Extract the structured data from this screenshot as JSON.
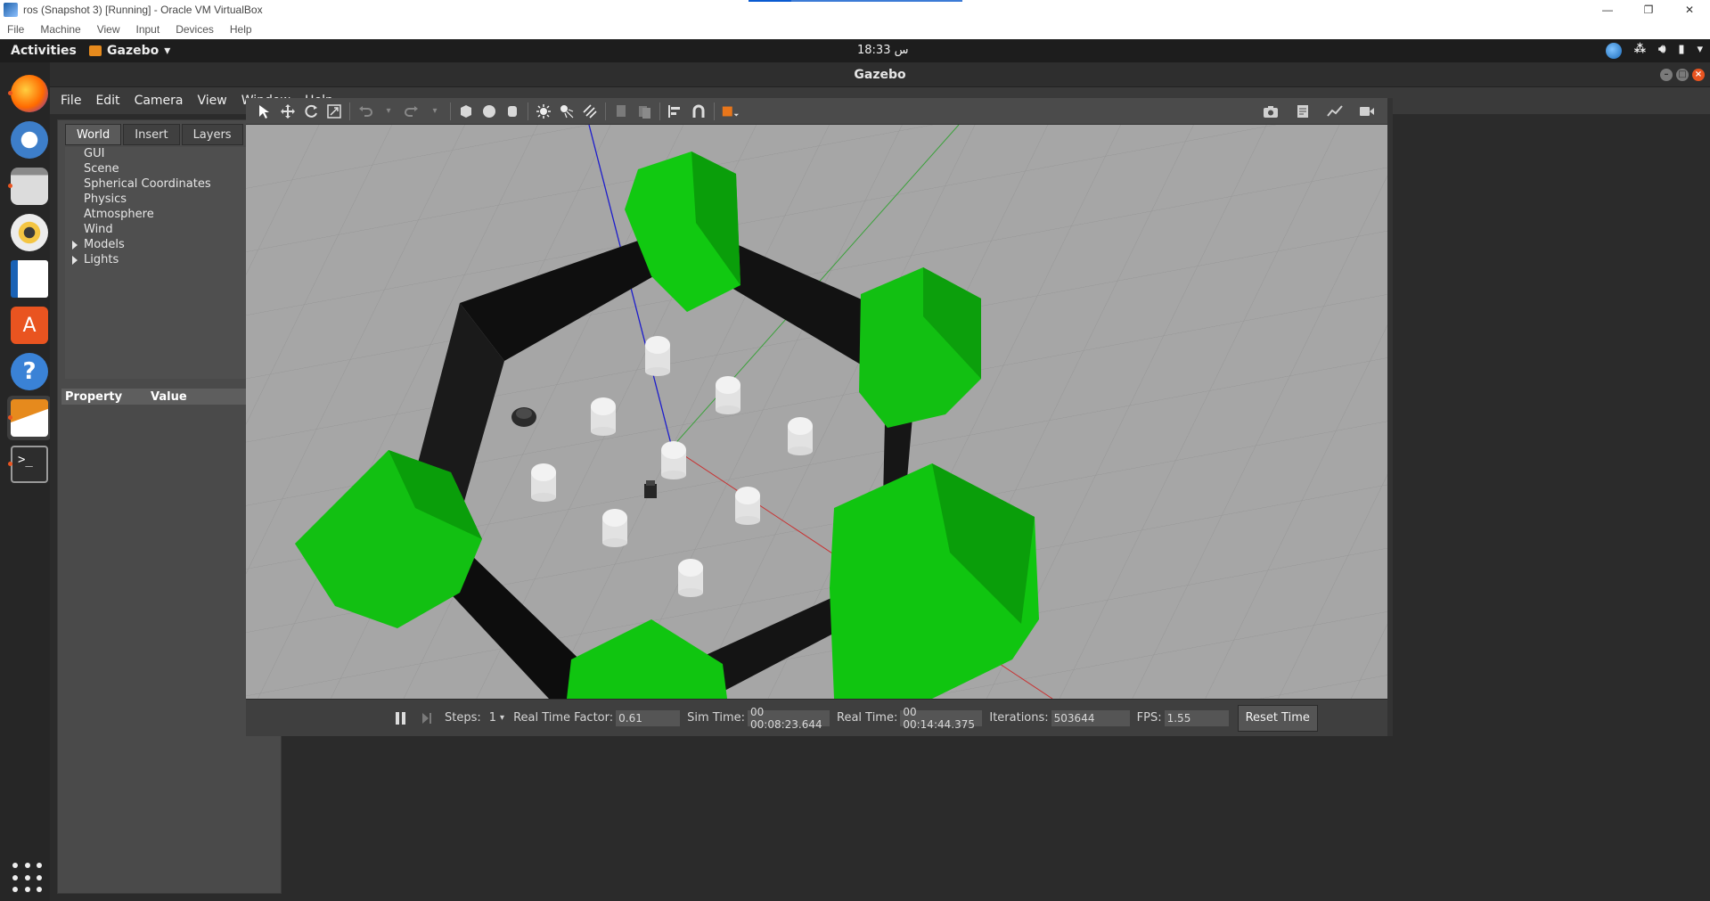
{
  "host": {
    "title": "ros (Snapshot 3) [Running] - Oracle VM VirtualBox",
    "menu": [
      "File",
      "Machine",
      "View",
      "Input",
      "Devices",
      "Help"
    ],
    "controls": [
      "—",
      "❐",
      "✕"
    ]
  },
  "topbar": {
    "activities": "Activities",
    "app": "Gazebo",
    "clock": "18:33 س"
  },
  "dock": {
    "items": [
      "firefox-icon",
      "thunderbird-icon",
      "files-icon",
      "rhythmbox-icon",
      "writer-icon",
      "software-icon",
      "help-icon",
      "gazebo-icon",
      "terminal-icon"
    ]
  },
  "gazebo": {
    "title": "Gazebo",
    "menu": [
      "File",
      "Edit",
      "Camera",
      "View",
      "Window",
      "Help"
    ],
    "tabs": [
      "World",
      "Insert",
      "Layers"
    ],
    "tree": [
      "GUI",
      "Scene",
      "Spherical Coordinates",
      "Physics",
      "Atmosphere",
      "Wind",
      "Models",
      "Lights"
    ],
    "property_header": {
      "property": "Property",
      "value": "Value"
    }
  },
  "bottom": {
    "steps_label": "Steps:",
    "steps_value": "1",
    "rtf_label": "Real Time Factor:",
    "rtf_value": "0.61",
    "sim_label": "Sim Time:",
    "sim_value": "00 00:08:23.644",
    "real_label": "Real Time:",
    "real_value": "00 00:14:44.375",
    "iter_label": "Iterations:",
    "iter_value": "503644",
    "fps_label": "FPS:",
    "fps_value": "1.55",
    "reset": "Reset Time"
  }
}
